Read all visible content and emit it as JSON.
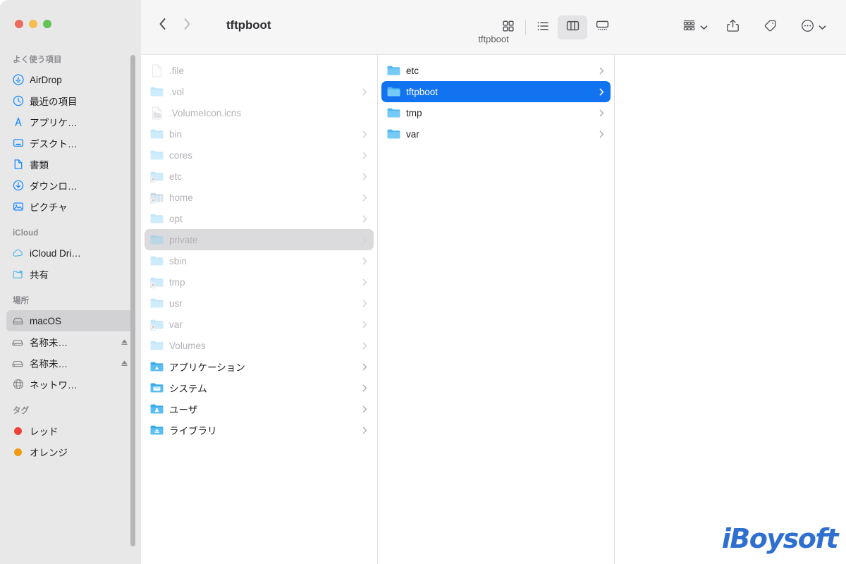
{
  "window": {
    "title": "tftpboot",
    "traffic_lights": [
      {
        "name": "close",
        "color": "#ec6a5e"
      },
      {
        "name": "minimize",
        "color": "#f4bd4f"
      },
      {
        "name": "maximize",
        "color": "#61c454"
      }
    ]
  },
  "toolbar": {
    "back_label": "‹",
    "forward_label": "›",
    "title": "tftpboot",
    "path_subtitle": "tftpboot",
    "view_modes": [
      {
        "id": "icon",
        "icon": "grid-view-icon",
        "active": false
      },
      {
        "id": "list",
        "icon": "list-view-icon",
        "active": false
      },
      {
        "id": "column",
        "icon": "column-view-icon",
        "active": true
      },
      {
        "id": "gallery",
        "icon": "gallery-view-icon",
        "active": false
      }
    ],
    "actions": [
      {
        "id": "group-by",
        "icon": "group-by-icon",
        "has_chevron": true
      },
      {
        "id": "share",
        "icon": "share-icon",
        "has_chevron": false
      },
      {
        "id": "tags",
        "icon": "tag-icon",
        "has_chevron": false
      },
      {
        "id": "more",
        "icon": "more-ellipsis-icon",
        "has_chevron": true
      }
    ]
  },
  "sidebar": {
    "sections": [
      {
        "title": "よく使う項目",
        "items": [
          {
            "label": "AirDrop",
            "icon": "airdrop-icon",
            "selected": false
          },
          {
            "label": "最近の項目",
            "icon": "clock-icon",
            "selected": false
          },
          {
            "label": "アプリケ…",
            "icon": "applications-icon",
            "selected": false
          },
          {
            "label": "デスクト…",
            "icon": "desktop-icon",
            "selected": false
          },
          {
            "label": "書類",
            "icon": "document-icon",
            "selected": false
          },
          {
            "label": "ダウンロ…",
            "icon": "downloads-icon",
            "selected": false
          },
          {
            "label": "ピクチャ",
            "icon": "pictures-icon",
            "selected": false
          }
        ]
      },
      {
        "title": "iCloud",
        "items": [
          {
            "label": "iCloud Dri…",
            "icon": "icloud-icon",
            "selected": false
          },
          {
            "label": "共有",
            "icon": "shared-folder-icon",
            "selected": false
          }
        ]
      },
      {
        "title": "場所",
        "items": [
          {
            "label": "macOS",
            "icon": "harddisk-icon",
            "selected": true,
            "eject": false
          },
          {
            "label": "名称未…",
            "icon": "external-disk-icon",
            "selected": false,
            "eject": true
          },
          {
            "label": "名称未…",
            "icon": "external-disk-icon",
            "selected": false,
            "eject": true
          },
          {
            "label": "ネットワ…",
            "icon": "network-icon",
            "selected": false,
            "eject": false
          }
        ]
      },
      {
        "title": "タグ",
        "items": [
          {
            "label": "レッド",
            "icon": "tag-dot",
            "color": "#f0403a",
            "selected": false
          },
          {
            "label": "オレンジ",
            "icon": "tag-dot",
            "color": "#ef9a12",
            "selected": false
          }
        ]
      }
    ]
  },
  "columns": [
    {
      "id": "column-1",
      "rows": [
        {
          "name": ".file",
          "icon": "file-generic-icon",
          "chevron": false,
          "dim": true,
          "state": "normal"
        },
        {
          "name": ".vol",
          "icon": "folder-icon",
          "chevron": true,
          "dim": true,
          "state": "normal"
        },
        {
          "name": ".VolumeIcon.icns",
          "icon": "image-file-icon",
          "chevron": false,
          "dim": true,
          "state": "normal"
        },
        {
          "name": "bin",
          "icon": "folder-icon",
          "chevron": true,
          "dim": true,
          "state": "normal"
        },
        {
          "name": "cores",
          "icon": "folder-icon",
          "chevron": true,
          "dim": true,
          "state": "normal"
        },
        {
          "name": "etc",
          "icon": "folder-alias-icon",
          "chevron": true,
          "dim": true,
          "state": "normal"
        },
        {
          "name": "home",
          "icon": "folder-alias-icon",
          "chevron": true,
          "dim": true,
          "state": "normal"
        },
        {
          "name": "opt",
          "icon": "folder-icon",
          "chevron": true,
          "dim": true,
          "state": "normal"
        },
        {
          "name": "private",
          "icon": "folder-icon",
          "chevron": true,
          "dim": true,
          "state": "hilite"
        },
        {
          "name": "sbin",
          "icon": "folder-icon",
          "chevron": true,
          "dim": true,
          "state": "normal"
        },
        {
          "name": "tmp",
          "icon": "folder-alias-icon",
          "chevron": true,
          "dim": true,
          "state": "normal"
        },
        {
          "name": "usr",
          "icon": "folder-icon",
          "chevron": true,
          "dim": true,
          "state": "normal"
        },
        {
          "name": "var",
          "icon": "folder-alias-icon",
          "chevron": true,
          "dim": true,
          "state": "normal"
        },
        {
          "name": "Volumes",
          "icon": "folder-icon",
          "chevron": true,
          "dim": true,
          "state": "normal"
        },
        {
          "name": "アプリケーション",
          "icon": "applications-folder-icon",
          "chevron": true,
          "dim": false,
          "state": "normal"
        },
        {
          "name": "システム",
          "icon": "system-folder-icon",
          "chevron": true,
          "dim": false,
          "state": "normal"
        },
        {
          "name": "ユーザ",
          "icon": "users-folder-icon",
          "chevron": true,
          "dim": false,
          "state": "normal"
        },
        {
          "name": "ライブラリ",
          "icon": "library-folder-icon",
          "chevron": true,
          "dim": false,
          "state": "normal"
        }
      ]
    },
    {
      "id": "column-2",
      "rows": [
        {
          "name": "etc",
          "icon": "folder-icon",
          "chevron": true,
          "dim": false,
          "state": "normal"
        },
        {
          "name": "tftpboot",
          "icon": "folder-icon",
          "chevron": true,
          "dim": false,
          "state": "selected"
        },
        {
          "name": "tmp",
          "icon": "folder-icon",
          "chevron": true,
          "dim": false,
          "state": "normal"
        },
        {
          "name": "var",
          "icon": "folder-icon",
          "chevron": true,
          "dim": false,
          "state": "normal"
        }
      ]
    },
    {
      "id": "column-3",
      "rows": []
    }
  ],
  "watermark": {
    "text": "iBoysoft",
    "color": "#2f6fd0"
  }
}
